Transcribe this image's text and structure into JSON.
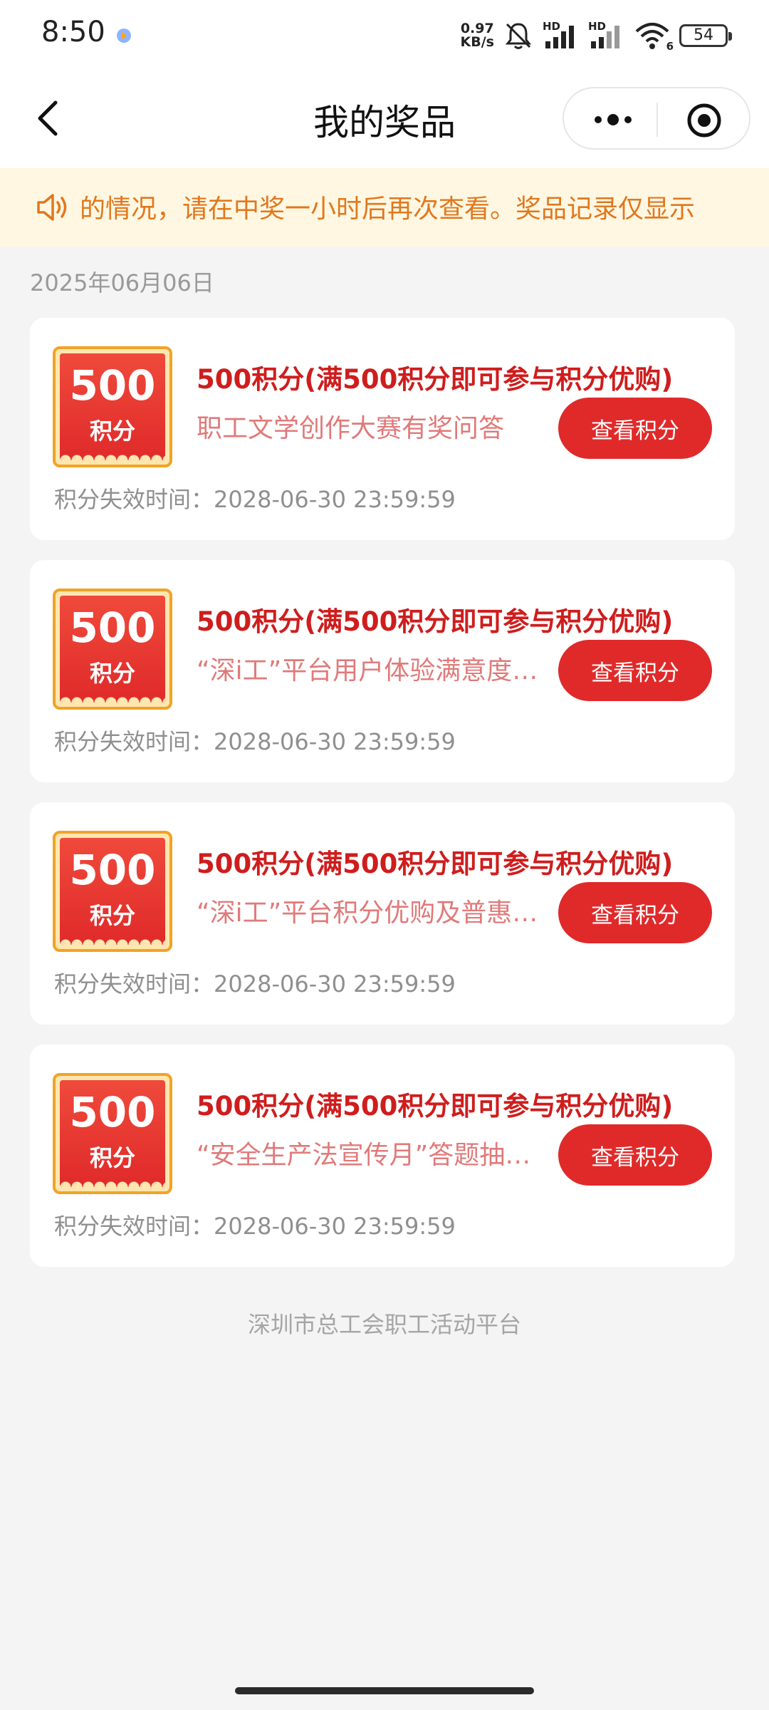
{
  "status_bar": {
    "time": "8:50",
    "net_speed_value": "0.97",
    "net_speed_unit": "KB/s",
    "network_badge_1": "HD",
    "network_badge_2": "HD",
    "wifi_badge": "6",
    "battery_level": "54"
  },
  "nav": {
    "title": "我的奖品"
  },
  "notice": {
    "text": "的情况，请在中奖一小时后再次查看。奖品记录仅显示"
  },
  "date": "2025年06月06日",
  "prizes": [
    {
      "badge_num": "500",
      "badge_unit": "积分",
      "title": "500积分(满500积分即可参与积分优购)",
      "source": "职工文学创作大赛有奖问答",
      "button": "查看积分",
      "expire": "积分失效时间：2028-06-30 23:59:59"
    },
    {
      "badge_num": "500",
      "badge_unit": "积分",
      "title": "500积分(满500积分即可参与积分优购)",
      "source": "“深i工”平台用户体验满意度…",
      "button": "查看积分",
      "expire": "积分失效时间：2028-06-30 23:59:59"
    },
    {
      "badge_num": "500",
      "badge_unit": "积分",
      "title": "500积分(满500积分即可参与积分优购)",
      "source": "“深i工”平台积分优购及普惠…",
      "button": "查看积分",
      "expire": "积分失效时间：2028-06-30 23:59:59"
    },
    {
      "badge_num": "500",
      "badge_unit": "积分",
      "title": "500积分(满500积分即可参与积分优购)",
      "source": "“安全生产法宣传月”答题抽…",
      "button": "查看积分",
      "expire": "积分失效时间：2028-06-30 23:59:59"
    }
  ],
  "footer": "深圳市总工会职工活动平台",
  "colors": {
    "accent_red": "#e02a2a",
    "title_red": "#cf1d1d",
    "notice_orange": "#e0781e",
    "notice_bg": "#fff7e2",
    "badge_gold": "#f1a326"
  },
  "icons": {
    "back": "chevron-left-icon",
    "more": "more-dots-icon",
    "close": "target-close-icon",
    "notice": "speaker-icon"
  }
}
